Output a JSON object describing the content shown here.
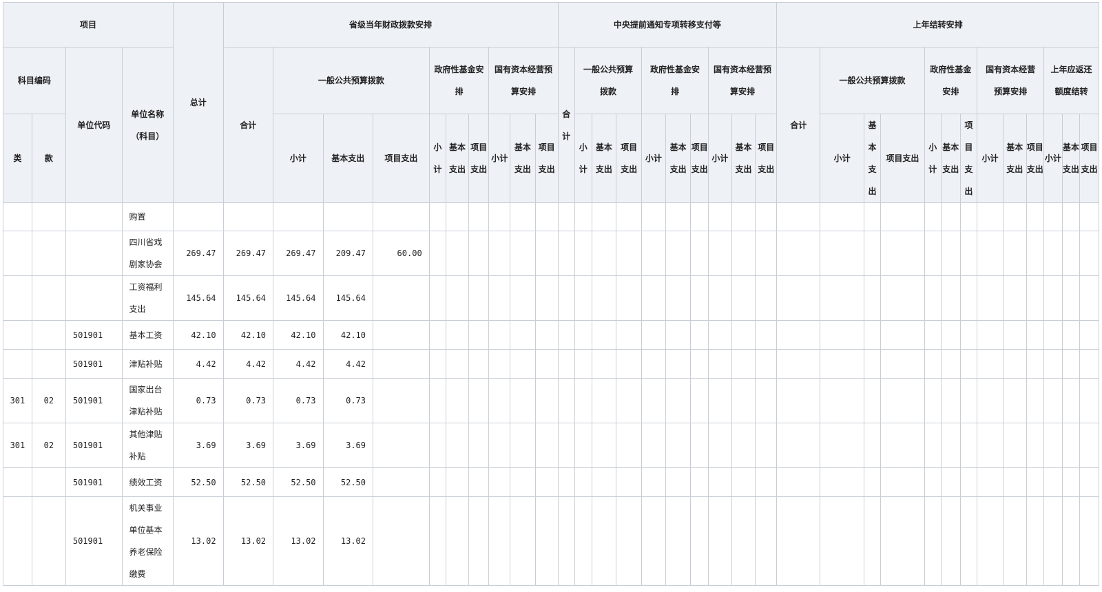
{
  "header": {
    "xiangmu": "项目",
    "kemu_bianma": "科目编码",
    "lei": "类",
    "kuan": "款",
    "danwei_daima": "单位代码",
    "danwei_mingcheng": "单位名称（科目）",
    "zongji": "总计",
    "g1": {
      "title": "省级当年财政拨款安排",
      "heji": "合计",
      "yiban": "一般公共预算拨款",
      "xiaoji": "小计",
      "jiben": "基本支出",
      "xiangmu": "项目支出",
      "zhengfu": "政府性基金安排",
      "zhengfu_sub": [
        "小计",
        "基本支出",
        "项目支出"
      ],
      "guoyou": "国有资本经营预算安排",
      "guoyou_sub": [
        "小计",
        "基本支出",
        "项目支出"
      ]
    },
    "g2": {
      "title": "中央提前通知专项转移支付等",
      "heji": "合计",
      "yiban": "一般公共预算拨款",
      "yiban_sub": [
        "小计",
        "基本支出",
        "项目支出"
      ],
      "zhengfu": "政府性基金安排",
      "zhengfu_sub": [
        "小计",
        "基本支出",
        "项目支出"
      ],
      "guoyou": "国有资本经营预算安排",
      "guoyou_sub": [
        "小计",
        "基本支出",
        "项目支出"
      ]
    },
    "g3": {
      "title": "上年结转安排",
      "heji": "合计",
      "yiban": "一般公共预算拨款",
      "yiban_sub": [
        "小计",
        "基本支出",
        "项目支出"
      ],
      "zhengfu": "政府性基金安排",
      "zhengfu_sub": [
        "小计",
        "基本支出",
        "项目支出"
      ],
      "guoyou": "国有资本经营预算安排",
      "guoyou_sub": [
        "小计",
        "基本支出",
        "项目支出"
      ],
      "huanfan": "上年应返还额度结转",
      "huanfan_sub": [
        "小计",
        "基本支出",
        "项目支出"
      ]
    }
  },
  "rows": [
    {
      "lei": "",
      "kuan": "",
      "code": "",
      "name": "购置",
      "zongji": "",
      "heji": "",
      "xiaoji": "",
      "jiben": "",
      "xiangmu": ""
    },
    {
      "lei": "",
      "kuan": "",
      "code": "",
      "name": "四川省戏剧家协会",
      "zongji": "269.47",
      "heji": "269.47",
      "xiaoji": "269.47",
      "jiben": "209.47",
      "xiangmu": "60.00"
    },
    {
      "lei": "",
      "kuan": "",
      "code": "",
      "name": "工资福利支出",
      "zongji": "145.64",
      "heji": "145.64",
      "xiaoji": "145.64",
      "jiben": "145.64",
      "xiangmu": ""
    },
    {
      "lei": "",
      "kuan": "",
      "code": "501901",
      "name": "基本工资",
      "zongji": "42.10",
      "heji": "42.10",
      "xiaoji": "42.10",
      "jiben": "42.10",
      "xiangmu": ""
    },
    {
      "lei": "",
      "kuan": "",
      "code": "501901",
      "name": "津贴补贴",
      "zongji": "4.42",
      "heji": "4.42",
      "xiaoji": "4.42",
      "jiben": "4.42",
      "xiangmu": ""
    },
    {
      "lei": "301",
      "kuan": "02",
      "code": "501901",
      "name": "国家出台津贴补贴",
      "zongji": "0.73",
      "heji": "0.73",
      "xiaoji": "0.73",
      "jiben": "0.73",
      "xiangmu": ""
    },
    {
      "lei": "301",
      "kuan": "02",
      "code": "501901",
      "name": "其他津贴补贴",
      "zongji": "3.69",
      "heji": "3.69",
      "xiaoji": "3.69",
      "jiben": "3.69",
      "xiangmu": ""
    },
    {
      "lei": "",
      "kuan": "",
      "code": "501901",
      "name": "绩效工资",
      "zongji": "52.50",
      "heji": "52.50",
      "xiaoji": "52.50",
      "jiben": "52.50",
      "xiangmu": ""
    },
    {
      "lei": "",
      "kuan": "",
      "code": "501901",
      "name": "机关事业单位基本养老保险缴费",
      "zongji": "13.02",
      "heji": "13.02",
      "xiaoji": "13.02",
      "jiben": "13.02",
      "xiangmu": ""
    }
  ]
}
